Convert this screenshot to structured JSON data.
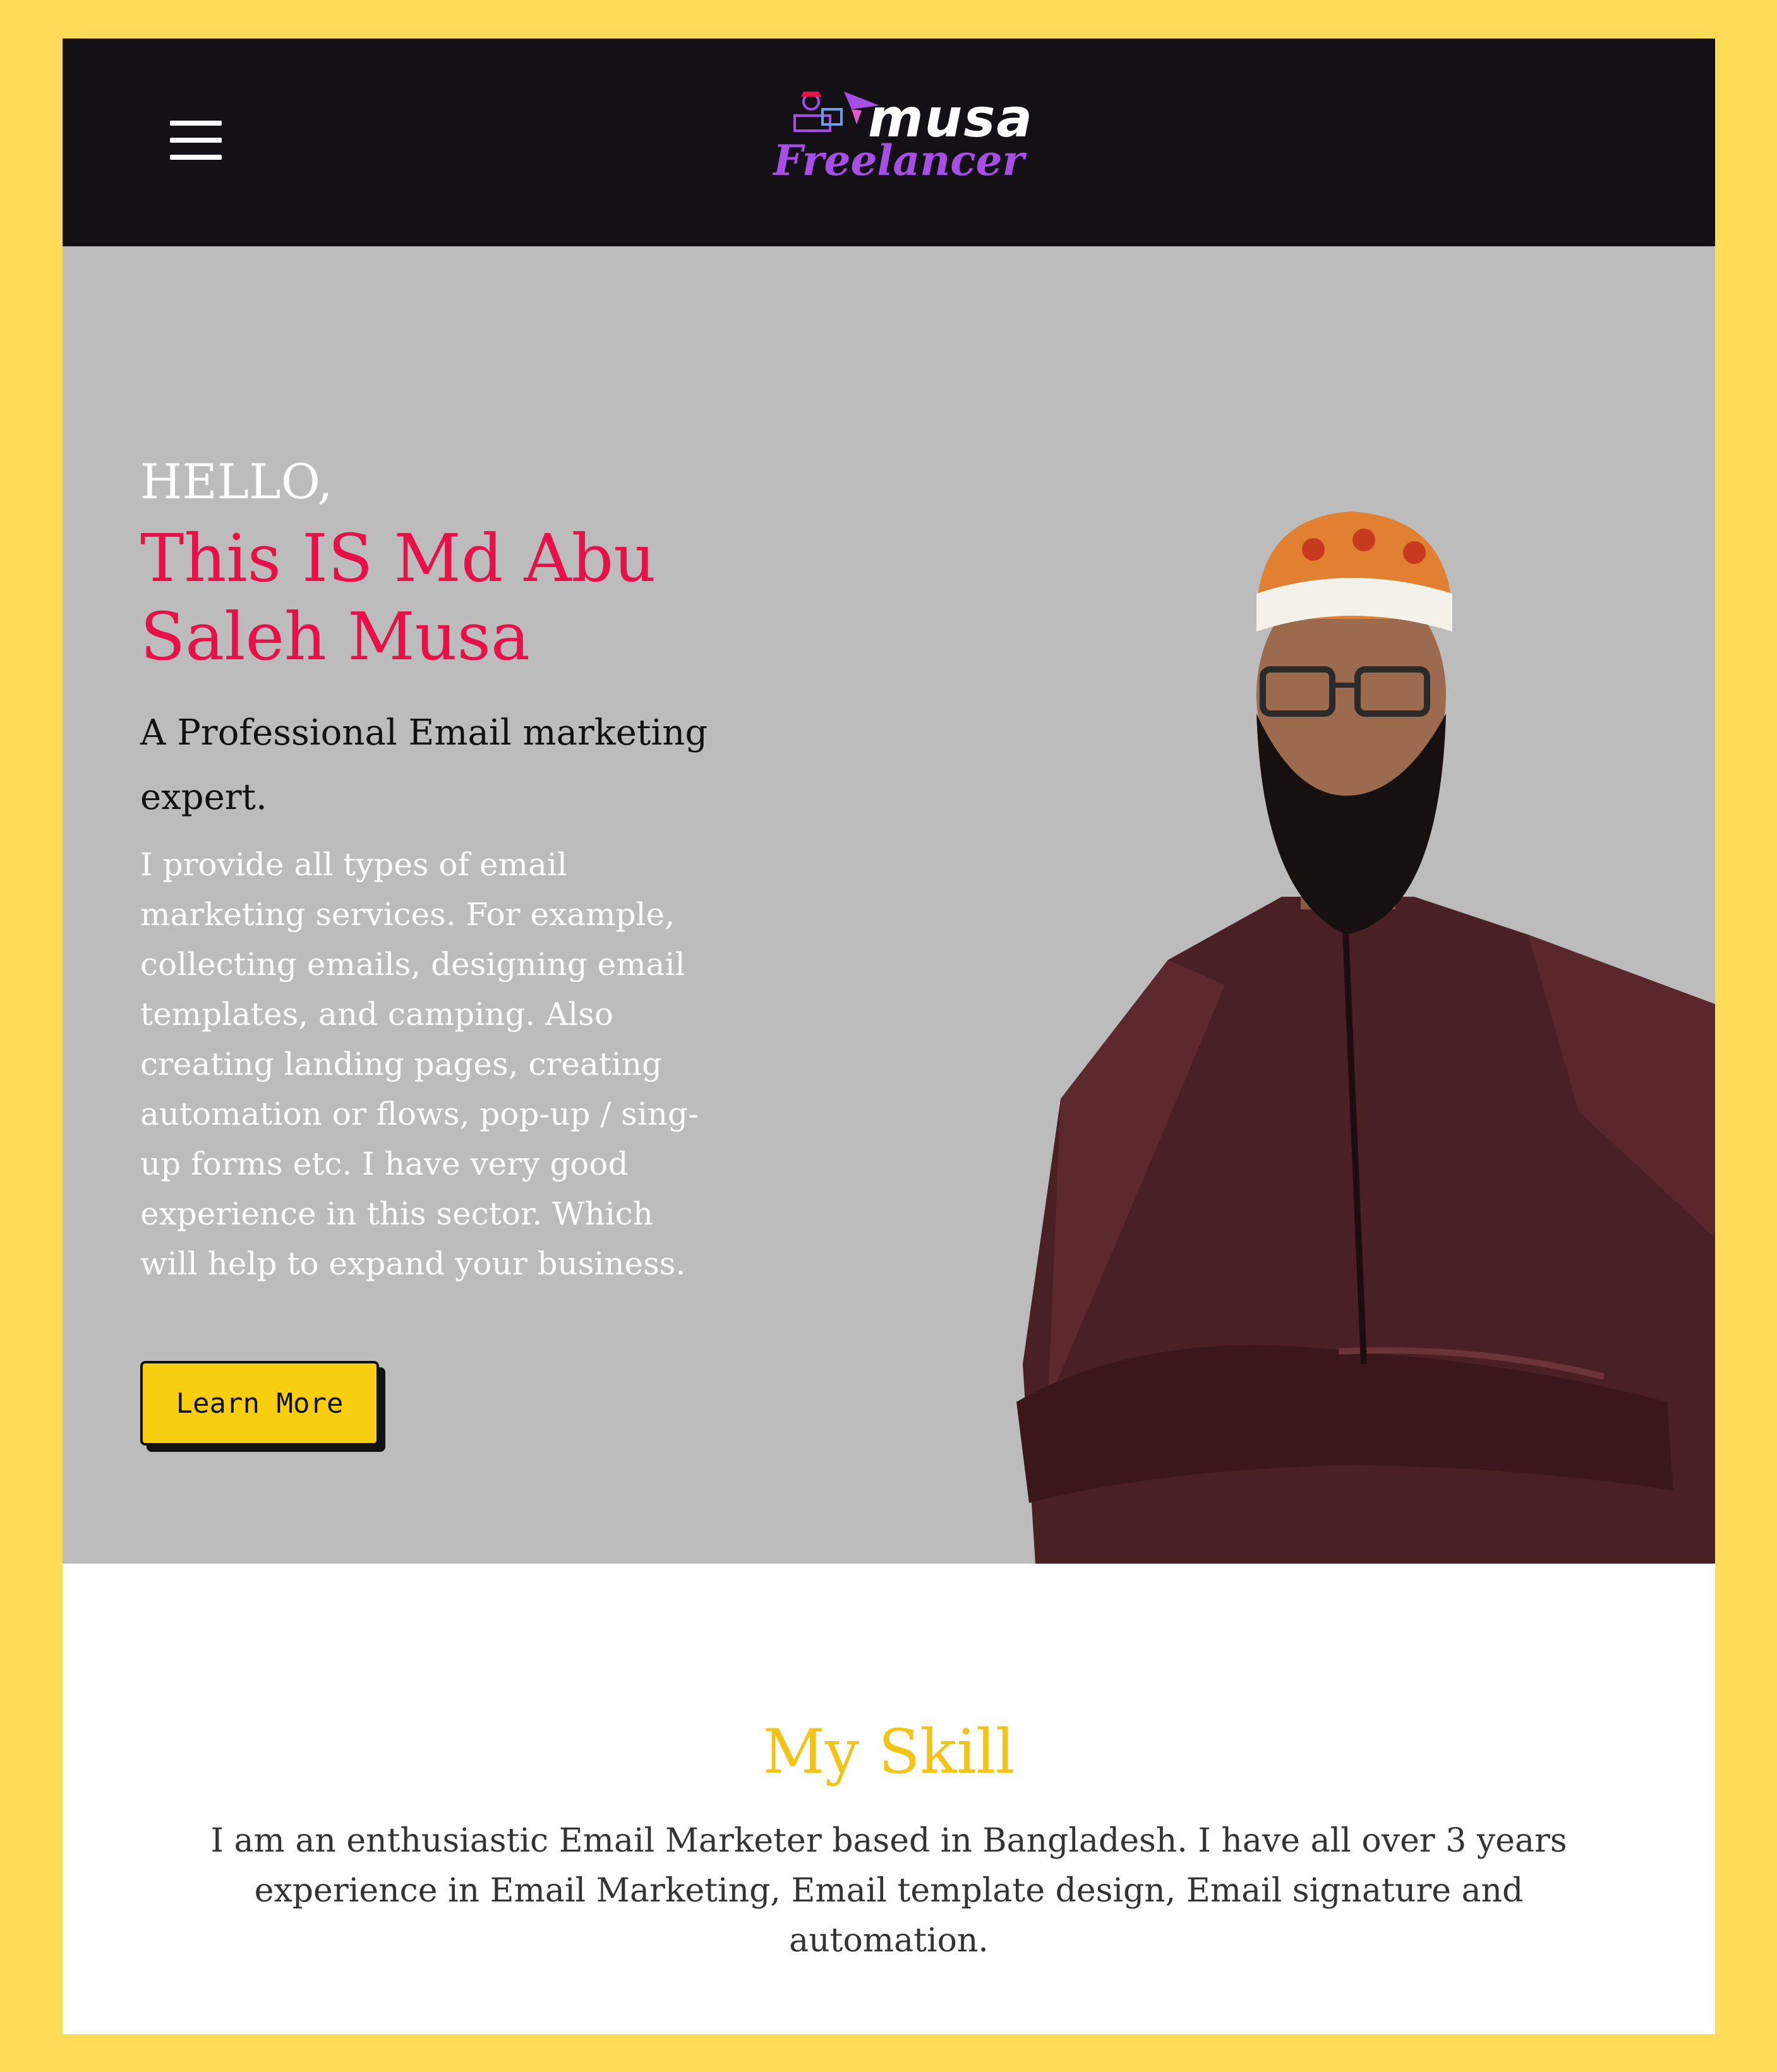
{
  "header": {
    "logo_top": "musa",
    "logo_bottom": "Freelancer",
    "menu_icon": "hamburger-icon",
    "background": "#131115"
  },
  "hero": {
    "greeting": "HELLO,",
    "name": "This IS Md Abu Saleh Musa",
    "subtitle": "A Professional Email marketing expert.",
    "description": "I provide all types of email marketing services. For example, collecting emails, designing email templates, and camping. Also creating landing pages, creating automation or flows, pop-up / sing-up forms etc. I have very good experience in this sector. Which will help to expand your business.",
    "cta_label": "Learn More",
    "background": "#bcbcbc",
    "name_color": "#e8104a",
    "cta_color": "#f8cf0f"
  },
  "skill": {
    "title": "My Skill",
    "text": "I am an enthusiastic Email Marketer based in Bangladesh. I have all over 3 years experience in Email Marketing, Email template design, Email signature and automation.",
    "title_color": "#f3c417"
  },
  "page": {
    "border_color": "#ffdb58"
  }
}
